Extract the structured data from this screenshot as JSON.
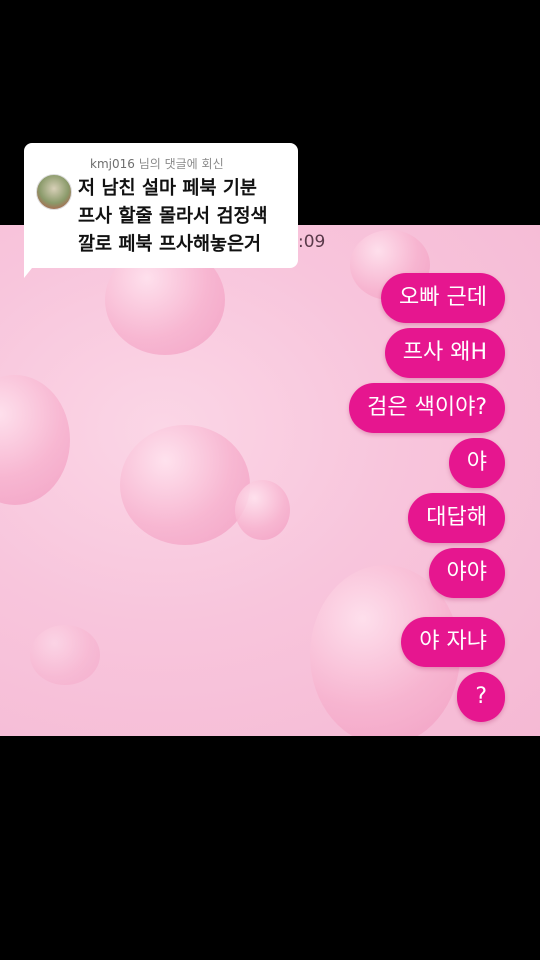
{
  "reply": {
    "username": "kmj016",
    "suffix": " 님의 댓글에 회신",
    "lines": [
      "저 남친 설마 페북 기분",
      "프사 할줄 몰라서 검정색",
      "깔로 페북 프사해놓은거"
    ]
  },
  "chat": {
    "time_fragment": ":09",
    "messages": [
      "오빠 근데",
      "프사 왜H",
      "검은 색이야?",
      "야",
      "대답해",
      "야야",
      "야 자냐",
      "?"
    ]
  },
  "colors": {
    "bubble": "#e6168f",
    "background": "#f8c5dc",
    "frame": "#000000"
  },
  "icons": {
    "avatar": "user-avatar"
  }
}
